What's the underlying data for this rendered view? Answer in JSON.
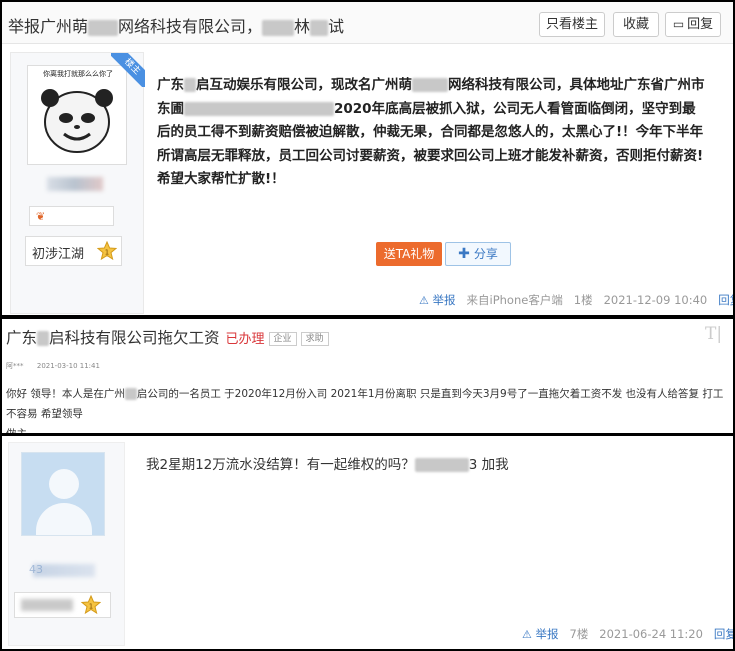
{
  "panel1": {
    "title_a": "举报广州萌",
    "title_b": "网络科技有限公司，",
    "title_c": "林",
    "title_d": "试",
    "buttons": {
      "only_op": "只看楼主",
      "favorite": "收藏",
      "reply": "回复"
    },
    "op_tag": "楼主",
    "meme_caption": "你离我打就那么么你了",
    "level_label": "初涉江湖",
    "level_number": "1",
    "post_lines": [
      "广东",
      "启互动娱乐有限公司，现改名广州萌",
      "网络科技有限公司，具体地址广东省广州市",
      "东圃",
      "2020年底高层被抓入狱，公司无人看管面临倒闭，坚守到最",
      "后的员工得不到薪资赔偿被迫解散，仲裁无果，合同都是忽悠人的，太黑心了!！今年下半年",
      "所谓高层无罪释放，员工回公司讨要薪资，被要求回公司上班才能发补薪资，否则拒付薪资!",
      "希望大家帮忙扩散!！"
    ],
    "gift_button": "送TA礼物",
    "share_button": "分享",
    "footer": {
      "report": "举报",
      "source": "来自iPhone客户端",
      "floor": "1楼",
      "time": "2021-12-09 10:40",
      "reply": "回复"
    }
  },
  "panel2": {
    "title_a": "广东",
    "title_b": "启科技有限公司拖欠工资",
    "status": "已办理",
    "tag1": "企业",
    "tag2": "求助",
    "logo": "T|",
    "author": "阿***",
    "time": "2021-03-10 11:41",
    "body_a": "你好 领导！本人是在广州",
    "body_b": "启公司的一名员工 于2020年12月份入司 2021年1月份离职 只是直到今天3月9号了一直拖欠着工资不发 也没有人给答复 打工不容易 希望领导",
    "body_c": "做主"
  },
  "panel3": {
    "text_a": "我2星期12万流水没结算！有一起维权的吗？",
    "text_b": "3 加我",
    "name_hint": "43",
    "level_number": "1",
    "footer": {
      "report": "举报",
      "floor": "7楼",
      "time": "2021-06-24 11:20",
      "reply": "回复"
    }
  },
  "colors": {
    "accent_blue": "#3a78c3",
    "gift_orange": "#ec6b2d",
    "status_red": "#d9373a"
  }
}
